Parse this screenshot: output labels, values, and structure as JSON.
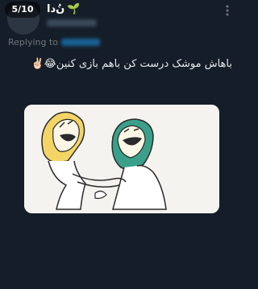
{
  "header": {
    "counter": "5/10",
    "display_name": "ﻥُدا",
    "name_emoji": "🌱",
    "more_icon": "more-vertical-icon"
  },
  "reply": {
    "label": "Replying to"
  },
  "tweet": {
    "text": "باهاش موشک درست کن باهم بازی کنین😂✌🏻"
  },
  "media": {
    "icon": "laughing-hug-cartoon"
  },
  "colors": {
    "background": "#151d28",
    "text": "#e7e9ea",
    "muted": "#71767b",
    "link": "#1d9bf0"
  }
}
